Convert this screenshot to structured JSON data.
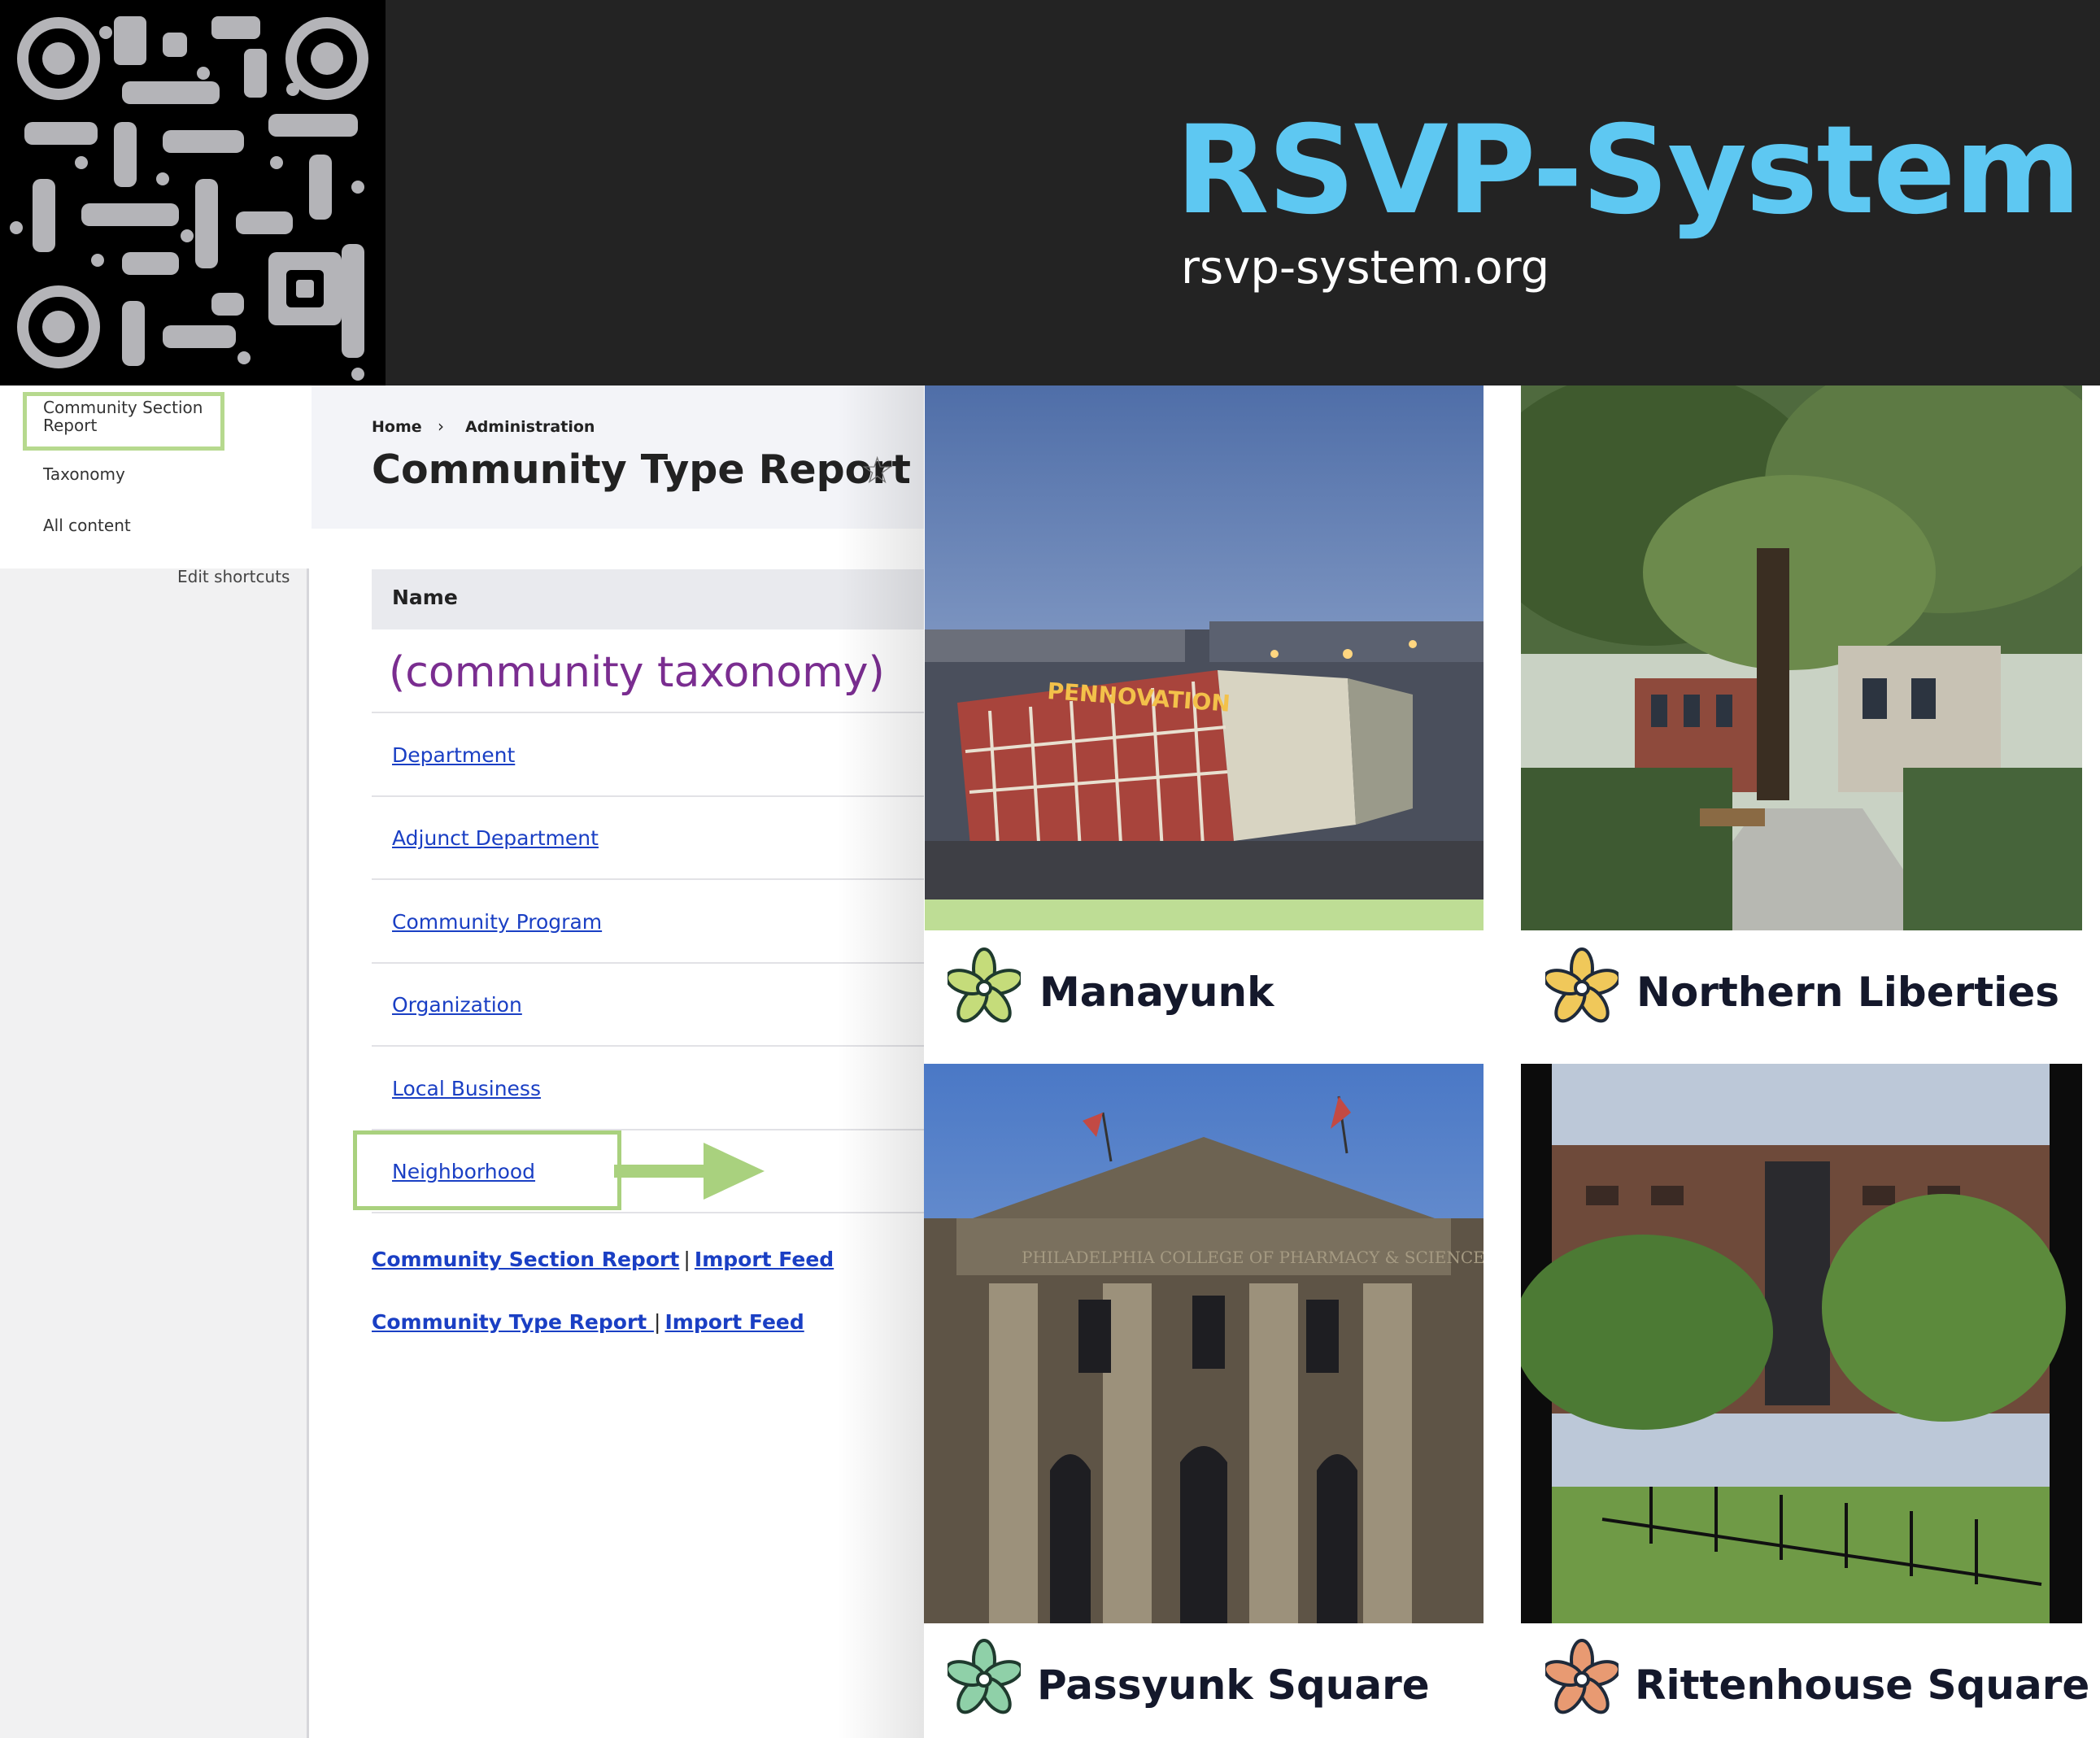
{
  "banner": {
    "title": "RSVP-System",
    "url": "rsvp-system.org"
  },
  "sidebar": {
    "items": [
      {
        "label": "Community Section Report",
        "highlighted": true
      },
      {
        "label": "Taxonomy"
      },
      {
        "label": "All content"
      }
    ],
    "edit_shortcuts_label": "Edit shortcuts"
  },
  "breadcrumb": {
    "home": "Home",
    "separator": "›",
    "current": "Administration"
  },
  "page": {
    "title": "Community Type Report",
    "favorite_icon": "☆"
  },
  "table": {
    "header": "Name",
    "note": "(community taxonomy)",
    "rows": [
      {
        "label": "Department"
      },
      {
        "label": "Adjunct Department"
      },
      {
        "label": "Community Program"
      },
      {
        "label": "Organization"
      },
      {
        "label": "Local Business"
      },
      {
        "label": "Neighborhood",
        "highlighted": true
      }
    ]
  },
  "footer_links": [
    {
      "primary": "Community Section Report",
      "separator": "|",
      "secondary": "Import Feed"
    },
    {
      "primary": "Community Type Report ",
      "separator": "|",
      "secondary": "Import Feed"
    }
  ],
  "neighborhoods": [
    {
      "name": "Manayunk",
      "photo_text": "PENNOVATION",
      "icon_color": "#c5dc7a"
    },
    {
      "name": "Northern Liberties",
      "icon_color": "#f0c85a"
    },
    {
      "name": "Passyunk Square",
      "photo_text": "PHILADELPHIA COLLEGE OF PHARMACY & SCIENCE",
      "icon_color": "#8fd0a8"
    },
    {
      "name": "Rittenhouse Square",
      "icon_color": "#e89a72"
    }
  ],
  "colors": {
    "brand_blue": "#5ec8f2",
    "highlight_green": "#a9d17e",
    "link_blue": "#1a3fc4",
    "note_purple": "#7a2d90"
  }
}
